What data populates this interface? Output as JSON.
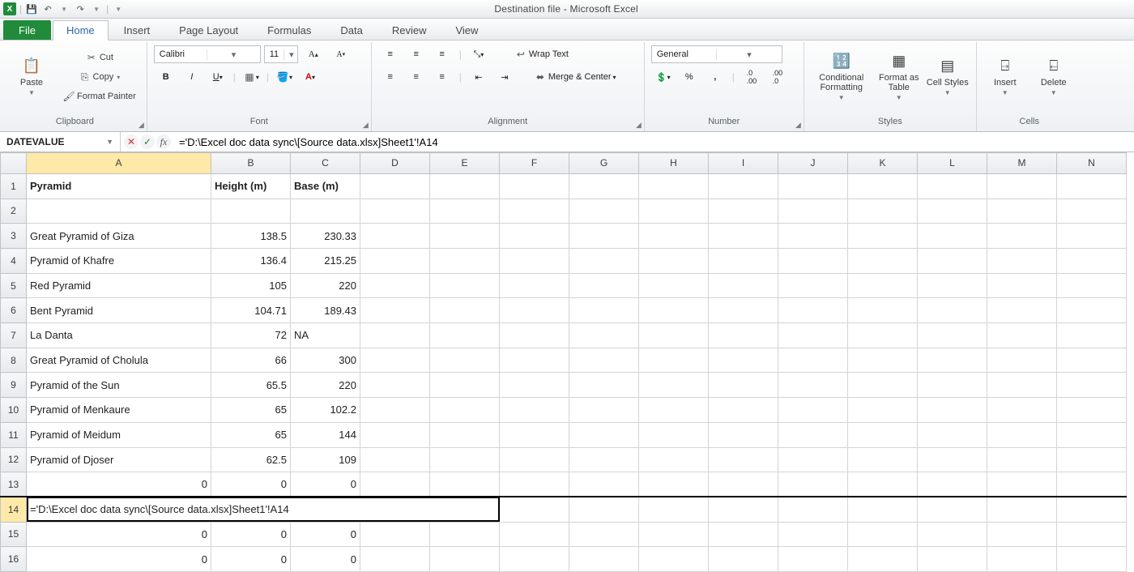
{
  "app": {
    "title": "Destination file  -  Microsoft Excel",
    "qat": {
      "save": "💾",
      "undo": "↶",
      "redo": "↷"
    }
  },
  "tabs": {
    "file": "File",
    "items": [
      "Home",
      "Insert",
      "Page Layout",
      "Formulas",
      "Data",
      "Review",
      "View"
    ],
    "active": "Home"
  },
  "ribbon": {
    "clipboard": {
      "label": "Clipboard",
      "paste": "Paste",
      "cut": "Cut",
      "copy": "Copy",
      "painter": "Format Painter"
    },
    "font": {
      "label": "Font",
      "name": "Calibri",
      "size": "11"
    },
    "alignment": {
      "label": "Alignment",
      "wrap": "Wrap Text",
      "merge": "Merge & Center"
    },
    "number": {
      "label": "Number",
      "format": "General"
    },
    "styles": {
      "label": "Styles",
      "cond": "Conditional Formatting",
      "table": "Format as Table",
      "cell": "Cell Styles"
    },
    "cells": {
      "label": "Cells",
      "insert": "Insert",
      "delete": "Delete"
    }
  },
  "formula_bar": {
    "name_box": "DATEVALUE",
    "formula": "='D:\\Excel doc data sync\\[Source data.xlsx]Sheet1'!A14"
  },
  "columns": [
    "A",
    "B",
    "C",
    "D",
    "E",
    "F",
    "G",
    "H",
    "I",
    "J",
    "K",
    "L",
    "M",
    "N"
  ],
  "headers": {
    "A": "Pyramid",
    "B": "Height (m)",
    "C": "Base (m)"
  },
  "rows": [
    {
      "A": "Great Pyramid of Giza",
      "B": "138.5",
      "C": "230.33"
    },
    {
      "A": "Pyramid of Khafre",
      "B": "136.4",
      "C": "215.25"
    },
    {
      "A": "Red Pyramid",
      "B": "105",
      "C": "220"
    },
    {
      "A": "Bent Pyramid",
      "B": "104.71",
      "C": "189.43"
    },
    {
      "A": "La Danta",
      "B": "72",
      "C": "NA"
    },
    {
      "A": "Great Pyramid of Cholula",
      "B": "66",
      "C": "300"
    },
    {
      "A": "Pyramid of the Sun",
      "B": "65.5",
      "C": "220"
    },
    {
      "A": "Pyramid of Menkaure",
      "B": "65",
      "C": "102.2"
    },
    {
      "A": "Pyramid of Meidum",
      "B": "65",
      "C": "144"
    },
    {
      "A": "Pyramid of Djoser",
      "B": "62.5",
      "C": "109"
    }
  ],
  "zero_rows": {
    "A": "0",
    "B": "0",
    "C": "0"
  },
  "editing_cell": {
    "row": 14,
    "display": "='D:\\Excel doc data sync\\[Source data.xlsx]Sheet1'!A14"
  },
  "chart_data": {
    "type": "table",
    "title": "Pyramid dimensions",
    "columns": [
      "Pyramid",
      "Height (m)",
      "Base (m)"
    ],
    "rows": [
      [
        "Great Pyramid of Giza",
        138.5,
        230.33
      ],
      [
        "Pyramid of Khafre",
        136.4,
        215.25
      ],
      [
        "Red Pyramid",
        105,
        220
      ],
      [
        "Bent Pyramid",
        104.71,
        189.43
      ],
      [
        "La Danta",
        72,
        null
      ],
      [
        "Great Pyramid of Cholula",
        66,
        300
      ],
      [
        "Pyramid of the Sun",
        65.5,
        220
      ],
      [
        "Pyramid of Menkaure",
        65,
        102.2
      ],
      [
        "Pyramid of Meidum",
        65,
        144
      ],
      [
        "Pyramid of Djoser",
        62.5,
        109
      ]
    ]
  }
}
